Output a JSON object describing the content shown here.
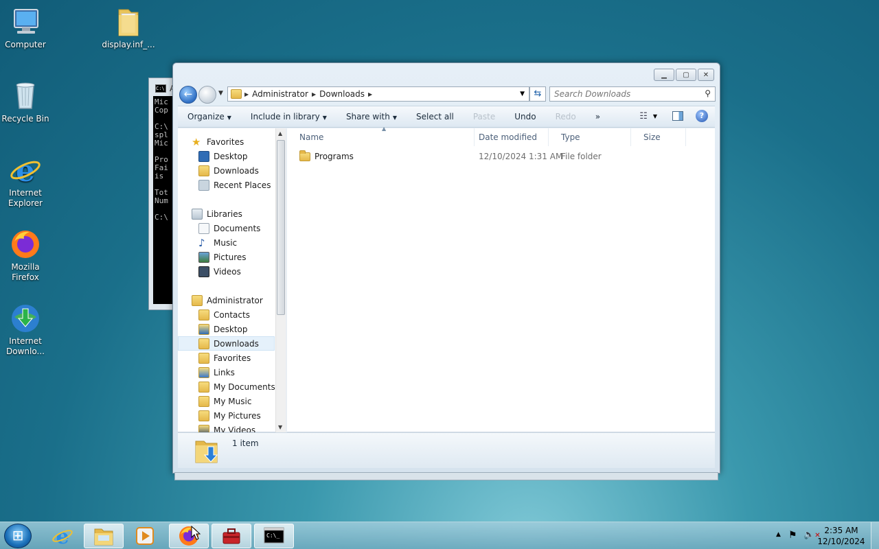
{
  "desktop": {
    "icons": [
      {
        "label": "Computer"
      },
      {
        "label": "display.inf_..."
      },
      {
        "label": "Recycle Bin"
      },
      {
        "label": "Internet Explorer"
      },
      {
        "label": "Mozilla Firefox"
      },
      {
        "label": "Internet Downlo..."
      }
    ]
  },
  "console": {
    "title": "A",
    "lines": "Mic\nCop\n\nC:\\\nspl\nMic\n\nPro\nFai\nis \n\nTot\nNum\n\nC:\\"
  },
  "explorer": {
    "address": {
      "crumbs": [
        "Administrator",
        "Downloads"
      ]
    },
    "search": {
      "placeholder": "Search Downloads"
    },
    "toolbar": {
      "organize": "Organize",
      "include": "Include in library",
      "share": "Share with",
      "select_all": "Select all",
      "paste": "Paste",
      "undo": "Undo",
      "redo": "Redo",
      "more": "»"
    },
    "nav": {
      "favorites": "Favorites",
      "desktop": "Desktop",
      "downloads": "Downloads",
      "recent": "Recent Places",
      "libraries": "Libraries",
      "documents": "Documents",
      "music": "Music",
      "pictures": "Pictures",
      "videos": "Videos",
      "administrator": "Administrator",
      "contacts": "Contacts",
      "adm_desktop": "Desktop",
      "adm_downloads": "Downloads",
      "adm_favorites": "Favorites",
      "links": "Links",
      "my_documents": "My Documents",
      "my_music": "My Music",
      "my_pictures": "My Pictures",
      "my_videos": "My Videos"
    },
    "columns": {
      "name": "Name",
      "date": "Date modified",
      "type": "Type",
      "size": "Size"
    },
    "files": [
      {
        "name": "Programs",
        "date": "12/10/2024 1:31 AM",
        "type": "File folder",
        "size": ""
      }
    ],
    "status": {
      "count": "1 item"
    }
  },
  "taskbar": {
    "time": "2:35 AM",
    "date": "12/10/2024"
  },
  "colors": {
    "accent": "#1a6fb8",
    "selection": "#e5f1fb"
  }
}
